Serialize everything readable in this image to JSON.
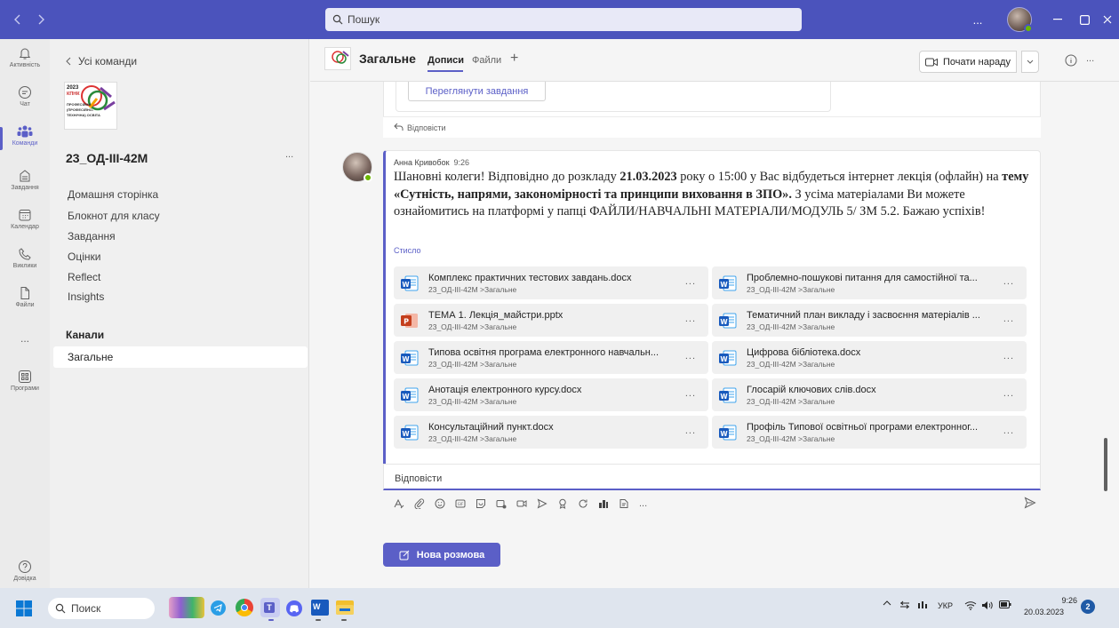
{
  "titlebar": {
    "search_placeholder": "Пошук",
    "more": "..."
  },
  "rail": {
    "items": [
      {
        "label": "Активність",
        "icon": "bell-icon"
      },
      {
        "label": "Чат",
        "icon": "chat-icon"
      },
      {
        "label": "Команди",
        "icon": "teams-icon"
      },
      {
        "label": "Завдання",
        "icon": "assignments-icon"
      },
      {
        "label": "Календар",
        "icon": "calendar-icon"
      },
      {
        "label": "Виклики",
        "icon": "phone-icon"
      },
      {
        "label": "Файли",
        "icon": "file-icon"
      },
      {
        "label": "Програми",
        "icon": "apps-icon"
      },
      {
        "label": "Довідка",
        "icon": "help-icon"
      }
    ],
    "more": "..."
  },
  "sidebar": {
    "back_label": "Усі команди",
    "team_name": "23_ОД-ІІІ-42М",
    "team_more": "...",
    "logo_text": [
      "2023",
      "КПНК",
      "ПРОФЕСІЙНА",
      "(ПРОФЕСІЙНО-",
      "ТЕХНІЧНА) ОСВІТА"
    ],
    "links": [
      "Домашня сторінка",
      "Блокнот для класу",
      "Завдання",
      "Оцінки",
      "Reflect",
      "Insights"
    ],
    "channels_heading": "Канали",
    "channels": [
      "Загальне"
    ]
  },
  "header": {
    "channel": "Загальне",
    "tabs": [
      "Дописи",
      "Файли"
    ],
    "add_tab": "+",
    "meet_label": "Почати нараду",
    "more": "..."
  },
  "prev_post": {
    "button": "Переглянути завдання",
    "reply": "Відповісти"
  },
  "post": {
    "author": "Анна Кривобок",
    "time": "9:26",
    "msg_a": "Шановні колеги! Відповідно до розкладу ",
    "msg_b": "21.03.2023",
    "msg_c": " року о 15:00 у Вас відбудеться інтернет лекція (офлайн) на ",
    "msg_d": "тему «Сутність, напрями, закономірності та принципи виховання в ЗПО».",
    "msg_e": " З усіма матеріалами Ви можете ознайомитись на платформі у папці ФАЙЛИ/НАВЧАЛЬНІ МАТЕРІАЛИ/МОДУЛЬ 5/ ЗМ 5.2. Бажаю успіхів!",
    "collapse": "Стисло",
    "files": [
      {
        "name": "Комплекс практичних тестових завдань.docx",
        "path": "23_ОД-ІІІ-42М >Загальне",
        "type": "word"
      },
      {
        "name": "Проблемно-пошукові питання для самостійної та...",
        "path": "23_ОД-ІІІ-42М >Загальне",
        "type": "word"
      },
      {
        "name": "ТЕМА 1. Лекція_майстри.pptx",
        "path": "23_ОД-ІІІ-42М >Загальне",
        "type": "ppt"
      },
      {
        "name": "Тематичний план викладу і засвоєння матеріалів ...",
        "path": "23_ОД-ІІІ-42М >Загальне",
        "type": "word"
      },
      {
        "name": "Типова освітня програма електронного навчальн...",
        "path": "23_ОД-ІІІ-42М >Загальне",
        "type": "word"
      },
      {
        "name": "Цифрова бібліотека.docx",
        "path": "23_ОД-ІІІ-42М >Загальне",
        "type": "word"
      },
      {
        "name": "Анотація електронного курсу.docx",
        "path": "23_ОД-ІІІ-42М >Загальне",
        "type": "word"
      },
      {
        "name": "Глосарій ключових слів.docx",
        "path": "23_ОД-ІІІ-42М >Загальне",
        "type": "word"
      },
      {
        "name": "Консультаційний пункт.docx",
        "path": "23_ОД-ІІІ-42М >Загальне",
        "type": "word"
      },
      {
        "name": "Профіль Типової освітньої програми електронног...",
        "path": "23_ОД-ІІІ-42М >Загальне",
        "type": "word"
      }
    ],
    "file_more": "...",
    "reply": "Відповісти"
  },
  "compose": {
    "new_conversation": "Нова розмова",
    "more": "..."
  },
  "taskbar": {
    "search": "Поиск",
    "lang": "УКР",
    "time": "9:26",
    "date": "20.03.2023",
    "badge": "2"
  },
  "colors": {
    "brand": "#4b53bc",
    "accent": "#5b5fc7"
  }
}
